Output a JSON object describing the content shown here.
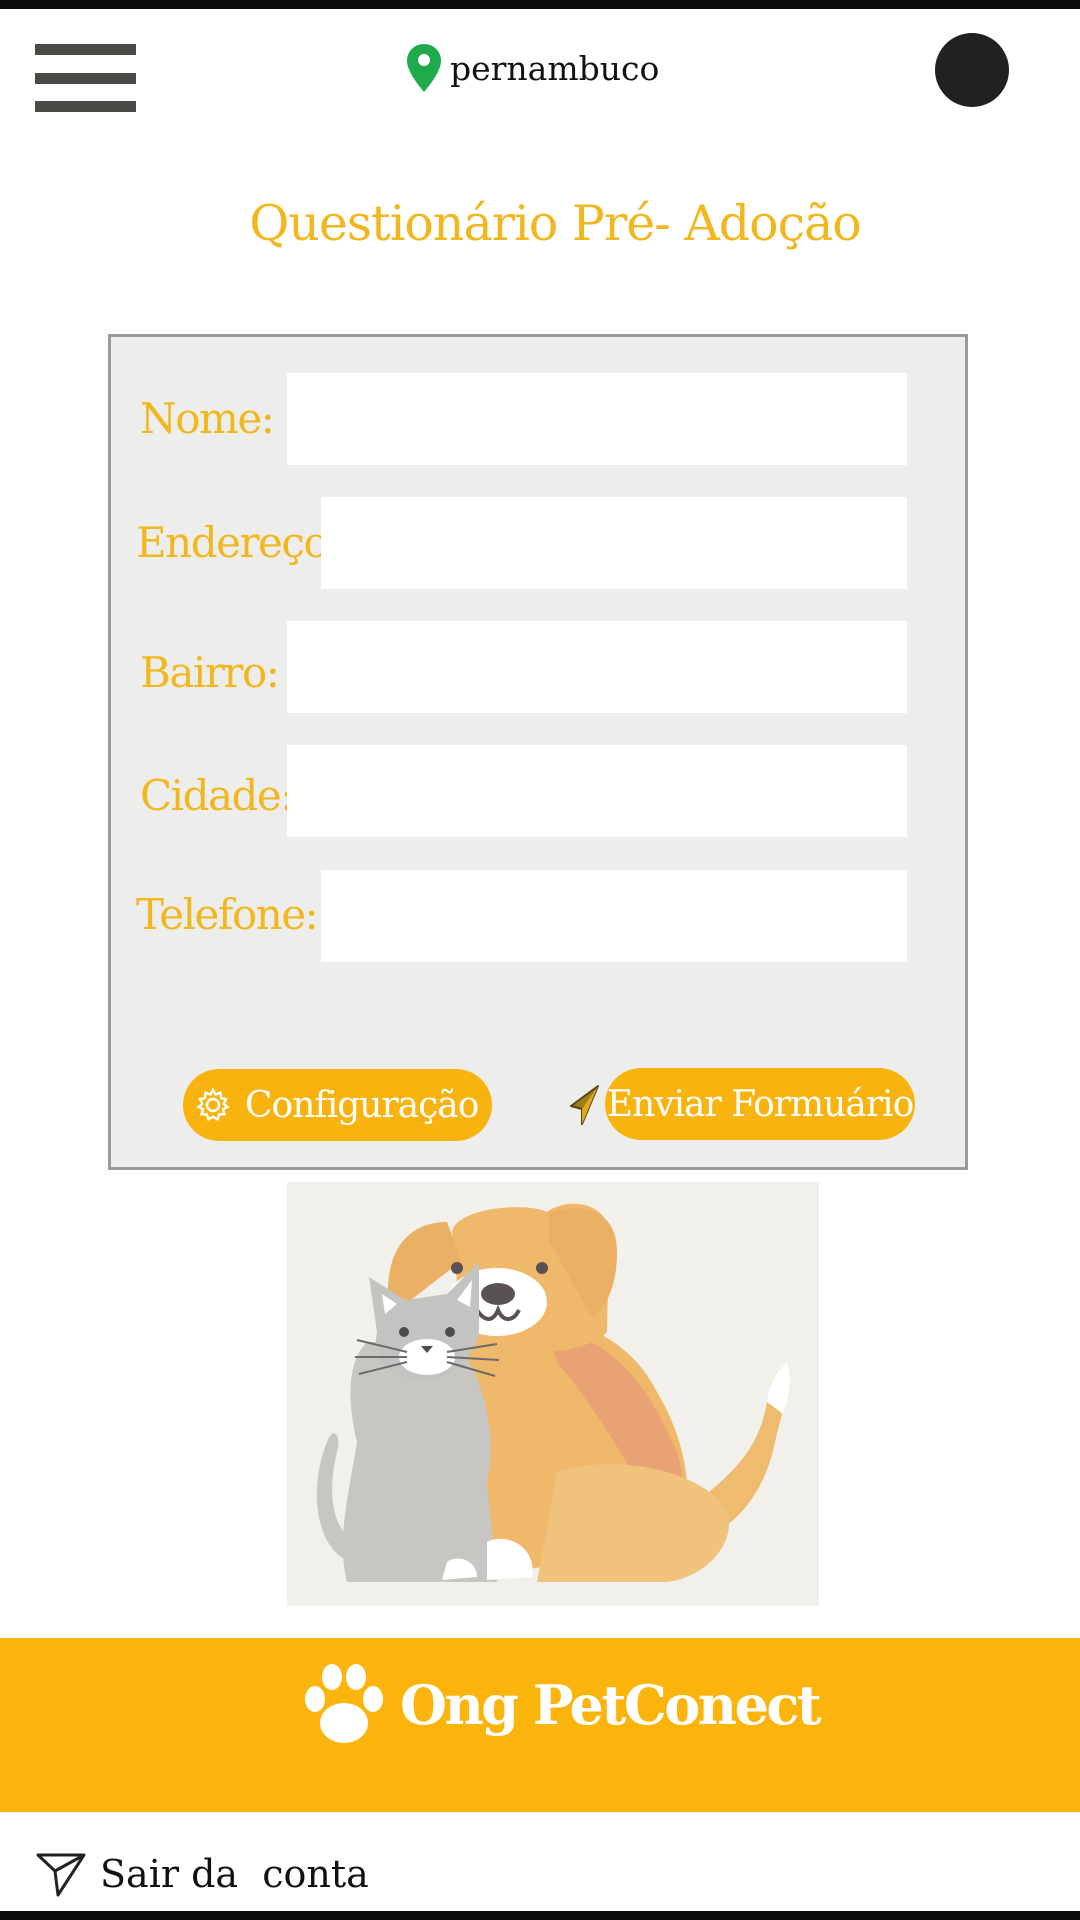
{
  "header": {
    "location": "pernambuco",
    "menu_icon": "hamburger-menu-icon",
    "location_icon": "map-pin-icon",
    "location_icon_color": "#1faa4b"
  },
  "page": {
    "title": "Questionário Pré- Adoção"
  },
  "form": {
    "fields": [
      {
        "label": "Nome:",
        "value": ""
      },
      {
        "label": "Endereço:",
        "value": ""
      },
      {
        "label": "Bairro:",
        "value": ""
      },
      {
        "label": "Cidade:",
        "value": ""
      },
      {
        "label": "Telefone:",
        "value": ""
      }
    ],
    "config_button": "Configuração",
    "send_button": "Enviar Formuário"
  },
  "illustration": {
    "subject": "dog-and-cat-illustration"
  },
  "footer": {
    "brand": "Ong PetConect",
    "logout": "Sair da  conta"
  },
  "colors": {
    "accent": "#f2b71e",
    "banner": "#fbb40b",
    "panel": "#ededeb"
  }
}
